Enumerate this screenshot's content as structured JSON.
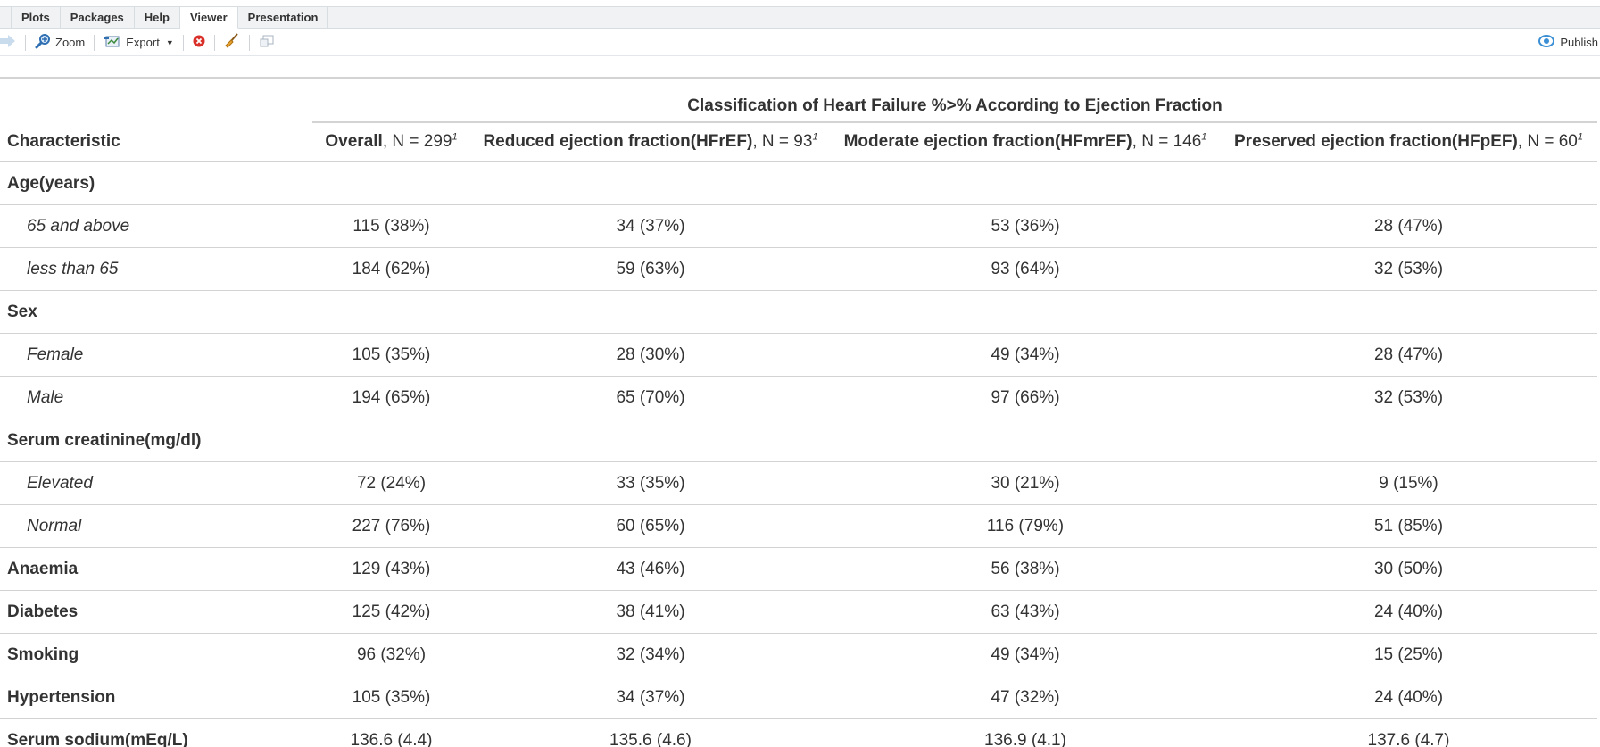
{
  "tabs": [
    {
      "label": "Plots",
      "active": false
    },
    {
      "label": "Packages",
      "active": false
    },
    {
      "label": "Help",
      "active": false
    },
    {
      "label": "Viewer",
      "active": true
    },
    {
      "label": "Presentation",
      "active": false
    }
  ],
  "toolbar": {
    "zoom_label": "Zoom",
    "export_label": "Export",
    "publish_label": "Publish",
    "icons": [
      "forward-arrow-icon",
      "zoom-icon",
      "export-icon",
      "clear-icon",
      "broom-icon",
      "new-window-icon",
      "publish-icon"
    ],
    "colors": {
      "clear": "#d9302a",
      "publish": "#3b8fd4",
      "broom": "#c9861a"
    }
  },
  "table": {
    "spanner": "Classification of Heart Failure %>% According to Ejection Fraction",
    "header": {
      "label": "Characteristic",
      "columns": [
        {
          "name": "Overall",
          "n": ", N = 299",
          "fn": "1"
        },
        {
          "name": "Reduced ejection fraction(HFrEF)",
          "n": ", N = 93",
          "fn": "1"
        },
        {
          "name": "Moderate ejection fraction(HFmrEF)",
          "n": ", N = 146",
          "fn": "1"
        },
        {
          "name": "Preserved ejection fraction(HFpEF)",
          "n": ", N = 60",
          "fn": "1"
        }
      ]
    },
    "rows": [
      {
        "label": "Age(years)",
        "type": "group",
        "values": [
          "",
          "",
          "",
          ""
        ]
      },
      {
        "label": "65 and above",
        "type": "level",
        "values": [
          "115 (38%)",
          "34 (37%)",
          "53 (36%)",
          "28 (47%)"
        ]
      },
      {
        "label": "less than 65",
        "type": "level",
        "values": [
          "184 (62%)",
          "59 (63%)",
          "93 (64%)",
          "32 (53%)"
        ]
      },
      {
        "label": "Sex",
        "type": "group",
        "values": [
          "",
          "",
          "",
          ""
        ]
      },
      {
        "label": "Female",
        "type": "level",
        "values": [
          "105 (35%)",
          "28 (30%)",
          "49 (34%)",
          "28 (47%)"
        ]
      },
      {
        "label": "Male",
        "type": "level",
        "values": [
          "194 (65%)",
          "65 (70%)",
          "97 (66%)",
          "32 (53%)"
        ]
      },
      {
        "label": "Serum creatinine(mg/dl)",
        "type": "group",
        "values": [
          "",
          "",
          "",
          ""
        ]
      },
      {
        "label": "Elevated",
        "type": "level",
        "values": [
          "72 (24%)",
          "33 (35%)",
          "30 (21%)",
          "9 (15%)"
        ]
      },
      {
        "label": "Normal",
        "type": "level",
        "values": [
          "227 (76%)",
          "60 (65%)",
          "116 (79%)",
          "51 (85%)"
        ]
      },
      {
        "label": "Anaemia",
        "type": "group",
        "values": [
          "129 (43%)",
          "43 (46%)",
          "56 (38%)",
          "30 (50%)"
        ]
      },
      {
        "label": "Diabetes",
        "type": "group",
        "values": [
          "125 (42%)",
          "38 (41%)",
          "63 (43%)",
          "24 (40%)"
        ]
      },
      {
        "label": "Smoking",
        "type": "group",
        "values": [
          "96 (32%)",
          "32 (34%)",
          "49 (34%)",
          "15 (25%)"
        ]
      },
      {
        "label": "Hypertension",
        "type": "group",
        "values": [
          "105 (35%)",
          "34 (37%)",
          "47 (32%)",
          "24 (40%)"
        ]
      },
      {
        "label": "Serum sodium(mEq/L)",
        "type": "group",
        "values": [
          "136.6 (4.4)",
          "135.6 (4.6)",
          "136.9 (4.1)",
          "137.6 (4.7)"
        ]
      }
    ]
  }
}
